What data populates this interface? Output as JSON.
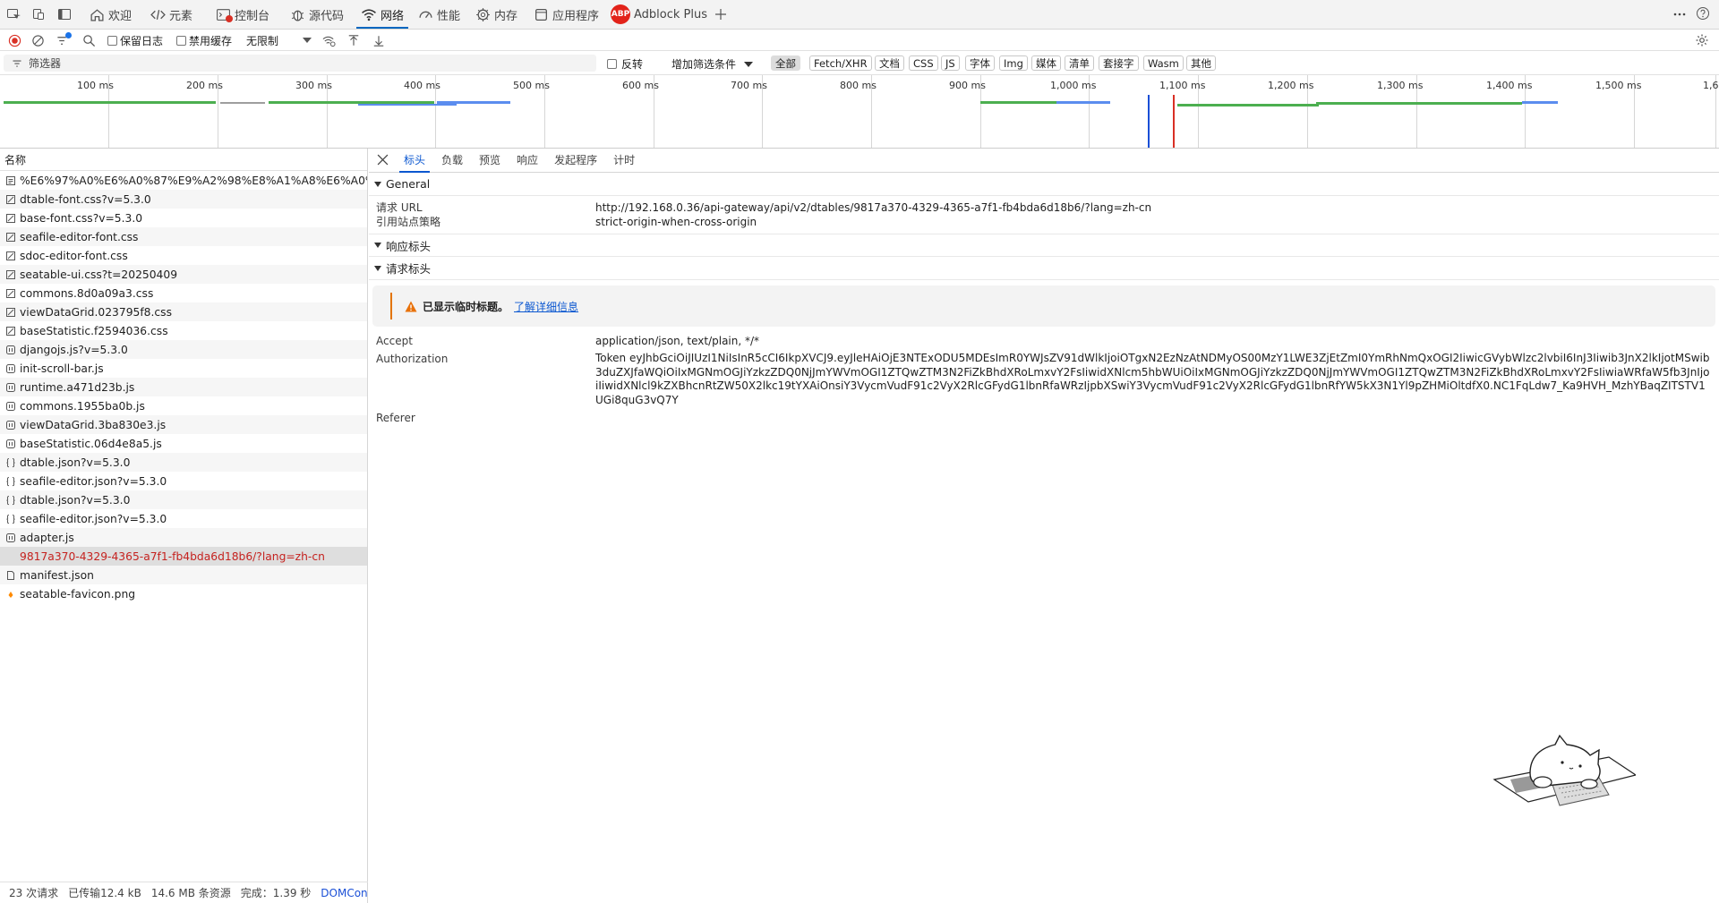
{
  "tabbar": {
    "tabs": [
      {
        "label": "欢迎",
        "icon": "home-icon"
      },
      {
        "label": "元素",
        "icon": "code-icon"
      },
      {
        "label": "控制台",
        "icon": "console-icon"
      },
      {
        "label": "源代码",
        "icon": "bug-icon"
      },
      {
        "label": "网络",
        "icon": "wifi-icon",
        "selected": true
      },
      {
        "label": "性能",
        "icon": "gauge-icon"
      },
      {
        "label": "内存",
        "icon": "memory-icon"
      },
      {
        "label": "应用程序",
        "icon": "application-icon"
      },
      {
        "label": "Adblock Plus",
        "icon": "abp-icon"
      }
    ],
    "abp_badge": "ABP"
  },
  "toolbar": {
    "preserve_log": "保留日志",
    "disable_cache": "禁用缓存",
    "throttling": "无限制"
  },
  "filterbar": {
    "placeholder": "筛选器",
    "invert": "反转",
    "more_filters": "增加筛选条件",
    "types": [
      "全部",
      "Fetch/XHR",
      "文档",
      "CSS",
      "JS",
      "字体",
      "Img",
      "媒体",
      "清单",
      "套接字",
      "Wasm",
      "其他"
    ],
    "selected_type": "全部"
  },
  "overview": {
    "ticks": [
      "100 ms",
      "200 ms",
      "300 ms",
      "400 ms",
      "500 ms",
      "600 ms",
      "700 ms",
      "800 ms",
      "900 ms",
      "1,000 ms",
      "1,100 ms",
      "1,200 ms",
      "1,300 ms",
      "1,400 ms",
      "1,500 ms",
      "1,6"
    ],
    "colors": {
      "green": "#4caf50",
      "blue": "#5b8def",
      "grey": "#9e9e9e",
      "dom_line": "#1a4fd6",
      "load_line": "#d93025"
    }
  },
  "requests": {
    "column_header": "名称",
    "items": [
      {
        "name": "%E6%97%A0%E6%A0%87%E9%A2%98%E8%A1%A8%E6%A0%B...",
        "type": "doc"
      },
      {
        "name": "dtable-font.css?v=5.3.0",
        "type": "css"
      },
      {
        "name": "base-font.css?v=5.3.0",
        "type": "css"
      },
      {
        "name": "seafile-editor-font.css",
        "type": "css"
      },
      {
        "name": "sdoc-editor-font.css",
        "type": "css"
      },
      {
        "name": "seatable-ui.css?t=20250409",
        "type": "css"
      },
      {
        "name": "commons.8d0a09a3.css",
        "type": "css"
      },
      {
        "name": "viewDataGrid.023795f8.css",
        "type": "css"
      },
      {
        "name": "baseStatistic.f2594036.css",
        "type": "css"
      },
      {
        "name": "djangojs.js?v=5.3.0",
        "type": "js"
      },
      {
        "name": "init-scroll-bar.js",
        "type": "js"
      },
      {
        "name": "runtime.a471d23b.js",
        "type": "js"
      },
      {
        "name": "commons.1955ba0b.js",
        "type": "js"
      },
      {
        "name": "viewDataGrid.3ba830e3.js",
        "type": "js"
      },
      {
        "name": "baseStatistic.06d4e8a5.js",
        "type": "js"
      },
      {
        "name": "dtable.json?v=5.3.0",
        "type": "json"
      },
      {
        "name": "seafile-editor.json?v=5.3.0",
        "type": "json"
      },
      {
        "name": "dtable.json?v=5.3.0",
        "type": "json"
      },
      {
        "name": "seafile-editor.json?v=5.3.0",
        "type": "json"
      },
      {
        "name": "adapter.js",
        "type": "js"
      },
      {
        "name": "9817a370-4329-4365-a7f1-fb4bda6d18b6/?lang=zh-cn",
        "type": "fetch",
        "selected": true
      },
      {
        "name": "manifest.json",
        "type": "manifest"
      },
      {
        "name": "seatable-favicon.png",
        "type": "img"
      }
    ]
  },
  "status": {
    "requests": "23 次请求",
    "transferred": "已传输12.4 kB",
    "resources": "14.6 MB 条资源",
    "finish": "完成：1.39 秒",
    "dom": "DOMConter"
  },
  "details": {
    "tabs": [
      "标头",
      "负载",
      "预览",
      "响应",
      "发起程序",
      "计时"
    ],
    "selected_tab": "标头",
    "general": {
      "title": "General",
      "rows": [
        {
          "key": "请求 URL",
          "value": "http://192.168.0.36/api-gateway/api/v2/dtables/9817a370-4329-4365-a7f1-fb4bda6d18b6/?lang=zh-cn"
        },
        {
          "key": "引用站点策略",
          "value": "strict-origin-when-cross-origin"
        }
      ]
    },
    "response_headers": {
      "title": "响应标头"
    },
    "request_headers": {
      "title": "请求标头",
      "warning": "已显示临时标题。",
      "learn_more": "了解详细信息",
      "rows": [
        {
          "key": "Accept",
          "value": "application/json, text/plain, */*"
        },
        {
          "key": "Authorization",
          "value": "Token eyJhbGciOiJIUzI1NiIsInR5cCI6IkpXVCJ9.eyJleHAiOjE3NTExODU5MDEsImR0YWJsZV91dWlkIjoiOTgxN2EzNzAtNDMyOS00MzY1LWE3ZjEtZmI0YmRhNmQxOGI2IiwicGVybWlzc2lvbiI6InJ3Iiwib3JnX2lkIjotMSwib3duZXJfaWQiOiIxMGNmOGJiYzkzZDQ0NjJmYWVmOGI1ZTQwZTM3N2FiZkBhdXRoLmxvY2FsIiwidXNlcm5hbWUiOiIxMGNmOGJiYzkzZDQ0NjJmYWVmOGI1ZTQwZTM3N2FiZkBhdXRoLmxvY2FsIiwiaWRfaW5fb3JnIjoiIiwidXNlcl9kZXBhcnRtZW50X2lkc19tYXAiOnsiY3VycmVudF91c2VyX2RlcGFydG1lbnRfaWRzIjpbXSwiY3VycmVudF91c2VyX2RlcGFydG1lbnRfYW5kX3N1Yl9pZHMiOltdfX0.NC1FqLdw7_Ka9HVH_MzhYBaqZITSTV1UGi8quG3vQ7Y"
        },
        {
          "key": "Referer",
          "value": ""
        }
      ]
    }
  }
}
